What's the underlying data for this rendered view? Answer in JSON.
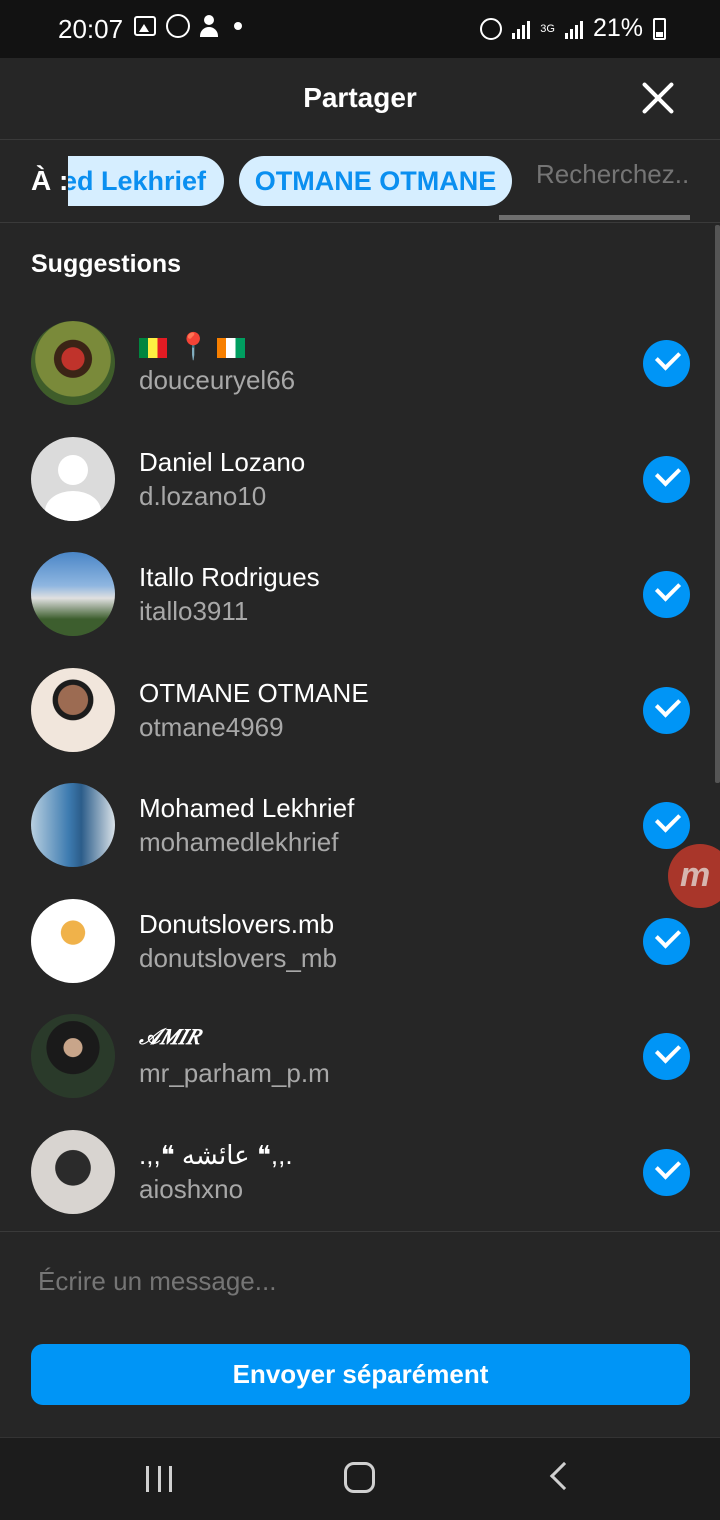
{
  "status_bar": {
    "time": "20:07",
    "network": "3G",
    "battery": "21%"
  },
  "header": {
    "title": "Partager",
    "close_icon": "close-icon"
  },
  "recipients": {
    "to_label": "À :",
    "chips": [
      "ed Lekhrief",
      "OTMANE OTMANE"
    ],
    "search_placeholder": "Recherchez.."
  },
  "suggestions": {
    "title": "Suggestions",
    "items": [
      {
        "name": "📍",
        "username": "douceuryel66",
        "selected": true
      },
      {
        "name": "Daniel Lozano",
        "username": "d.lozano10",
        "selected": true
      },
      {
        "name": "Itallo Rodrigues",
        "username": "itallo3911",
        "selected": true
      },
      {
        "name": "OTMANE OTMANE",
        "username": "otmane4969",
        "selected": true
      },
      {
        "name": "Mohamed Lekhrief",
        "username": "mohamedlekhrief",
        "selected": true
      },
      {
        "name": "Donutslovers.mb",
        "username": "donutslovers_mb",
        "selected": true
      },
      {
        "name": "𝒜𝑀𝐼𝑅",
        "username": "mr_parham_p.m",
        "selected": true
      },
      {
        "name": ".,,❝ عائشه ❝,,.",
        "username": "aioshxno",
        "selected": true
      }
    ]
  },
  "floating_bubble": {
    "letter": "m"
  },
  "composer": {
    "placeholder": "Écrire un message...",
    "send_label": "Envoyer séparément"
  },
  "colors": {
    "accent": "#0095f6",
    "background": "#262626",
    "chip_bg": "#d6eeff"
  }
}
